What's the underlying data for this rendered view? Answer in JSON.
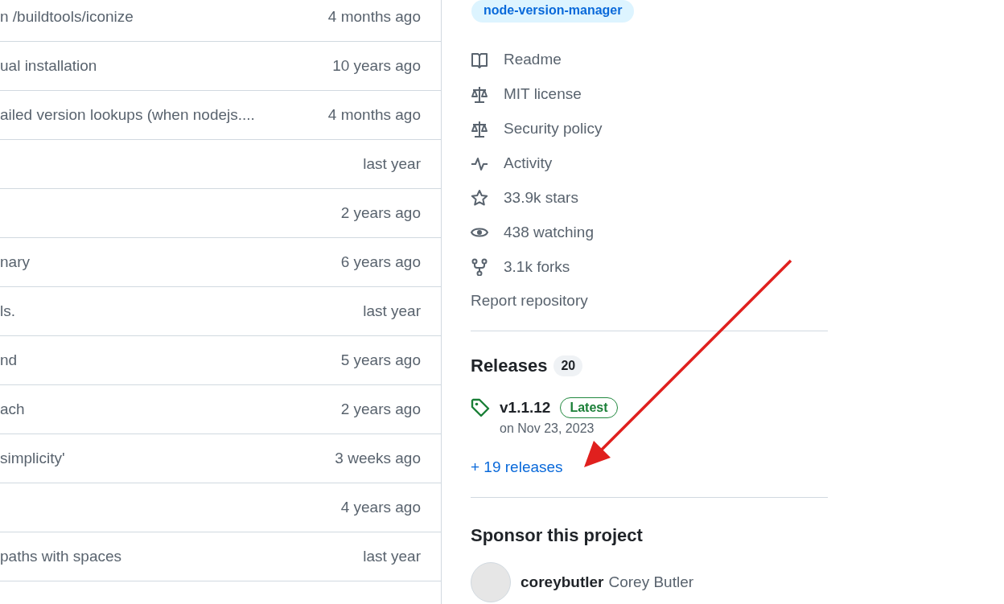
{
  "file_rows": [
    {
      "message": "n /buildtools/iconize",
      "time": "4 months ago"
    },
    {
      "message": "ual installation",
      "time": "10 years ago"
    },
    {
      "message": "ailed version lookups (when nodejs....",
      "time": "4 months ago"
    },
    {
      "time": "last year"
    },
    {
      "time": "2 years ago"
    },
    {
      "message": "nary",
      "time": "6 years ago"
    },
    {
      "message": "ls.",
      "time": "last year"
    },
    {
      "message": "nd",
      "time": "5 years ago"
    },
    {
      "message": "ach",
      "time": "2 years ago"
    },
    {
      "message": "simplicity'",
      "time": "3 weeks ago"
    },
    {
      "time": "4 years ago"
    },
    {
      "message": "paths with spaces",
      "time": "last year"
    }
  ],
  "about": {
    "topic": "node-version-manager",
    "links": [
      {
        "kind": "book",
        "label": "Readme"
      },
      {
        "kind": "scale",
        "label": "MIT license"
      },
      {
        "kind": "scale",
        "label": "Security policy"
      },
      {
        "kind": "pulse",
        "label": "Activity"
      },
      {
        "kind": "star",
        "label": "33.9k stars"
      },
      {
        "kind": "eye",
        "label": "438 watching"
      },
      {
        "kind": "fork",
        "label": "3.1k forks"
      }
    ],
    "report": "Report repository"
  },
  "releases": {
    "title": "Releases",
    "count": "20",
    "latest": {
      "tag": "v1.1.12",
      "badge": "Latest",
      "date": "on Nov 23, 2023"
    },
    "more": "+ 19 releases"
  },
  "sponsor": {
    "title": "Sponsor this project",
    "login": "coreybutler",
    "name": "Corey Butler"
  }
}
